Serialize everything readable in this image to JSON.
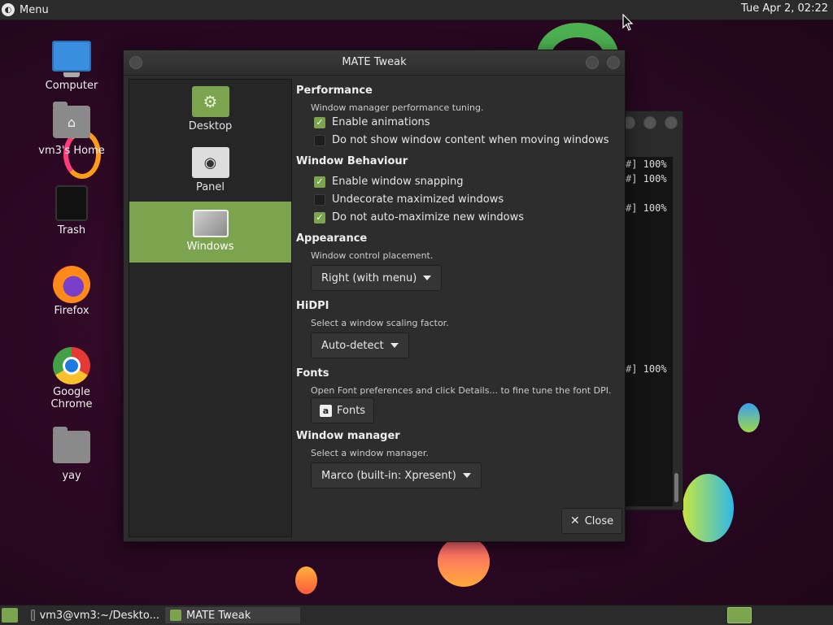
{
  "top_panel": {
    "menu_label": "Menu",
    "clock": "Tue Apr  2, 02:22"
  },
  "desktop_icons": [
    {
      "label": "Computer",
      "icon": "computer-icon"
    },
    {
      "label": "vm3's Home",
      "icon": "home-folder-icon"
    },
    {
      "label": "Trash",
      "icon": "trash-icon"
    },
    {
      "label": "Firefox",
      "icon": "firefox-icon"
    },
    {
      "label": "Google Chrome",
      "icon": "chrome-icon"
    },
    {
      "label": "yay",
      "icon": "folder-icon"
    }
  ],
  "terminal_lines": [
    "#] 100%",
    "#] 100%",
    "#] 100%",
    "#] 100%"
  ],
  "dialog": {
    "title": "MATE Tweak",
    "sidebar": [
      {
        "label": "Desktop",
        "active": false
      },
      {
        "label": "Panel",
        "active": false
      },
      {
        "label": "Windows",
        "active": true
      }
    ],
    "sections": {
      "performance": {
        "title": "Performance",
        "desc": "Window manager performance tuning.",
        "options": [
          {
            "label": "Enable animations",
            "checked": true
          },
          {
            "label": "Do not show window content when moving windows",
            "checked": false
          }
        ]
      },
      "window_behaviour": {
        "title": "Window Behaviour",
        "options": [
          {
            "label": "Enable window snapping",
            "checked": true
          },
          {
            "label": "Undecorate maximized windows",
            "checked": false
          },
          {
            "label": "Do not auto-maximize new windows",
            "checked": true
          }
        ]
      },
      "appearance": {
        "title": "Appearance",
        "desc": "Window control placement.",
        "selected": "Right (with menu)"
      },
      "hidpi": {
        "title": "HiDPI",
        "desc": "Select a window scaling factor.",
        "selected": "Auto-detect"
      },
      "fonts": {
        "title": "Fonts",
        "desc": "Open Font preferences and click Details... to fine tune the font DPI.",
        "button": "Fonts"
      },
      "window_manager": {
        "title": "Window manager",
        "desc": "Select a window manager.",
        "selected": "Marco (built-in: Xpresent)"
      }
    },
    "close_label": "Close"
  },
  "taskbar": {
    "items": [
      {
        "label": "vm3@vm3:~/Deskto...",
        "active": false
      },
      {
        "label": "MATE Tweak",
        "active": true
      }
    ]
  },
  "colors": {
    "accent": "#7ca34e",
    "panel": "#2b2b2b",
    "dialog": "#2d2d2d"
  }
}
